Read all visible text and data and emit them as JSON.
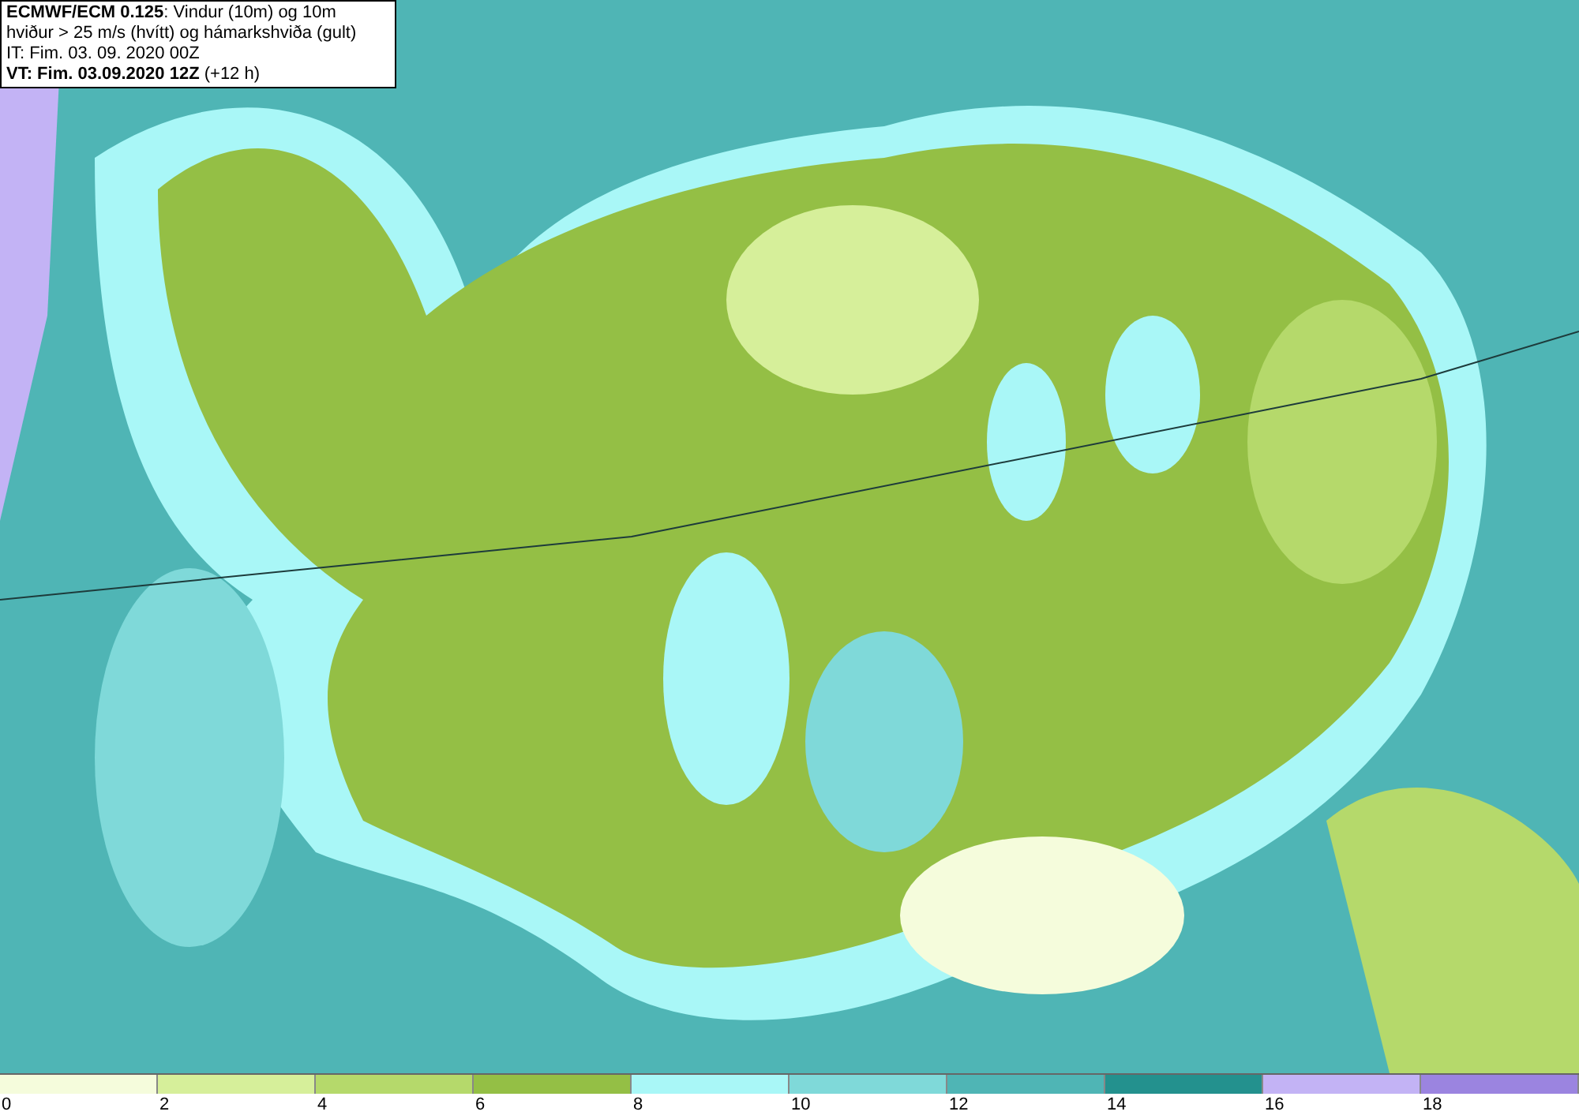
{
  "header": {
    "lines": [
      "**ECMWF/ECM 0.125**: Vindur (10m) og 10m",
      "hviður > 25 m/s (hvítt) og hámarkshviða (gult)",
      "IT: Fim. 03. 09. 2020 00Z",
      "**VT: Fim. 03.09.2020 12Z** (+12 h)"
    ]
  },
  "legend": {
    "swatches": [
      {
        "label": "0",
        "color": "#f5fcdc"
      },
      {
        "label": "2",
        "color": "#d6ef9a"
      },
      {
        "label": "4",
        "color": "#b5d96b"
      },
      {
        "label": "6",
        "color": "#94bf45"
      },
      {
        "label": "8",
        "color": "#a9f7f7"
      },
      {
        "label": "10",
        "color": "#7fd9d9"
      },
      {
        "label": "12",
        "color": "#4fb5b5"
      },
      {
        "label": "14",
        "color": "#23918e"
      },
      {
        "label": "16",
        "color": "#c3b3f5"
      },
      {
        "label": "18",
        "color": "#9b84e0"
      }
    ]
  }
}
